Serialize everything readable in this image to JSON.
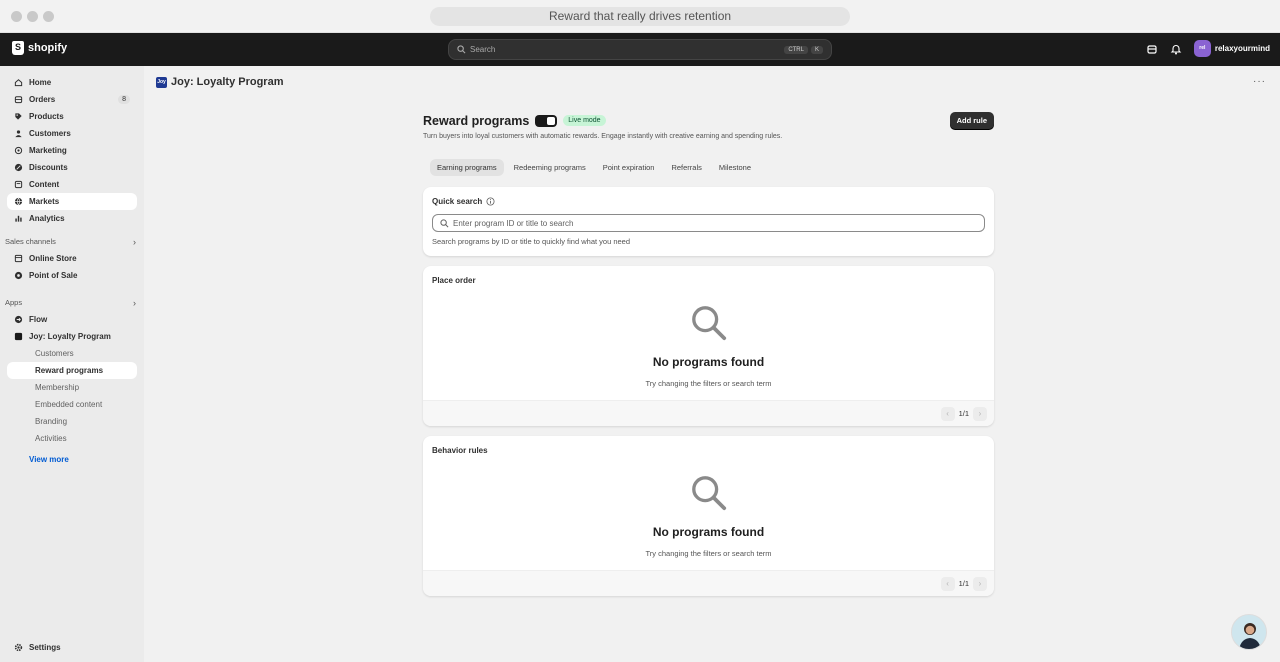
{
  "browser": {
    "tab_title": "Reward that really drives retention"
  },
  "topbar": {
    "brand": "shopify",
    "search_placeholder": "Search",
    "shortcut_keys": [
      "CTRL",
      "K"
    ],
    "user_initials": "rel",
    "user_name": "relaxyourmind"
  },
  "sidebar": {
    "items": [
      {
        "label": "Home",
        "icon": "home-icon"
      },
      {
        "label": "Orders",
        "icon": "orders-icon",
        "badge": "8"
      },
      {
        "label": "Products",
        "icon": "tag-icon"
      },
      {
        "label": "Customers",
        "icon": "person-icon"
      },
      {
        "label": "Marketing",
        "icon": "target-icon"
      },
      {
        "label": "Discounts",
        "icon": "discount-icon"
      },
      {
        "label": "Content",
        "icon": "content-icon"
      },
      {
        "label": "Markets",
        "icon": "globe-icon"
      },
      {
        "label": "Analytics",
        "icon": "chart-icon"
      }
    ],
    "sales_channels_label": "Sales channels",
    "sales_channels": [
      {
        "label": "Online Store",
        "icon": "store-icon"
      },
      {
        "label": "Point of Sale",
        "icon": "pos-icon"
      }
    ],
    "apps_label": "Apps",
    "apps": [
      {
        "label": "Flow",
        "icon": "flow-icon"
      },
      {
        "label": "Joy: Loyalty Program",
        "icon": "joy-icon"
      }
    ],
    "app_sub": [
      "Customers",
      "Reward programs",
      "Membership",
      "Embedded content",
      "Branding",
      "Activities"
    ],
    "view_more": "View more",
    "settings": "Settings"
  },
  "app": {
    "title": "Joy: Loyalty Program",
    "icon_text": "Joy"
  },
  "page": {
    "title": "Reward programs",
    "mode_badge": "Live mode",
    "add_rule": "Add rule",
    "description": "Turn buyers into loyal customers with automatic rewards. Engage instantly with creative earning and spending rules.",
    "tabs": [
      "Earning programs",
      "Redeeming programs",
      "Point expiration",
      "Referrals",
      "Milestone"
    ]
  },
  "quick_search": {
    "label": "Quick search",
    "placeholder": "Enter program ID or title to search",
    "help": "Search programs by ID or title to quickly find what you need"
  },
  "sections": [
    {
      "title": "Place order",
      "empty_title": "No programs found",
      "empty_text": "Try changing the filters or search term",
      "page": "1/1"
    },
    {
      "title": "Behavior rules",
      "empty_title": "No programs found",
      "empty_text": "Try changing the filters or search term",
      "page": "1/1"
    }
  ],
  "colors": {
    "topbar": "#1a1a1a",
    "live_badge_bg": "#c7f4d6",
    "link": "#005bd3",
    "avatar": "#8a63d2"
  }
}
